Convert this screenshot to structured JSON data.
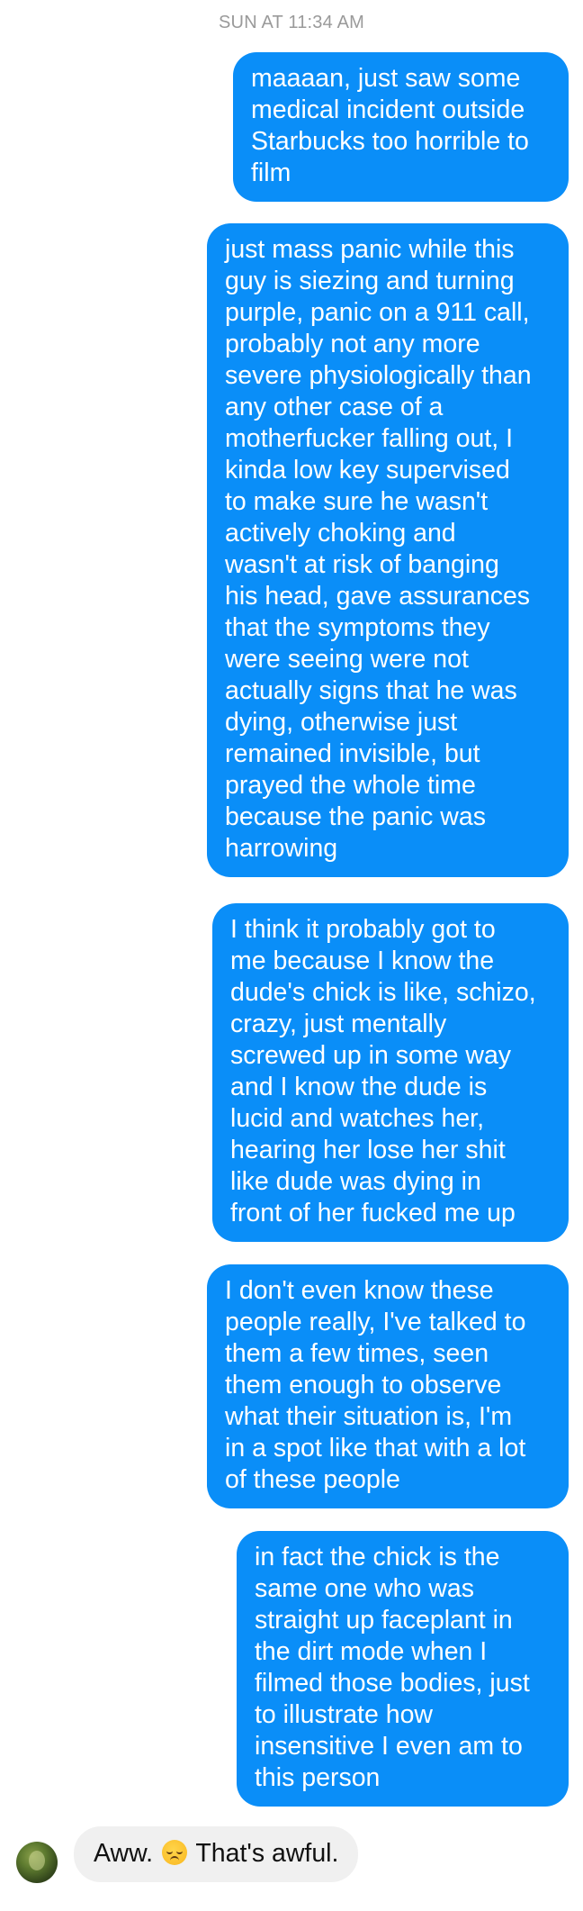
{
  "conversation": {
    "timestamp": "SUN AT 11:34 AM",
    "outgoing_messages": [
      {
        "text": "maaaan, just saw some\nmedical incident outside\nStarbucks too horrible to\nfilm"
      },
      {
        "text": "just mass panic while this\nguy is siezing and turning\npurple, panic on a 911 call,\nprobably not any more\nsevere physiologically than\nany other case of a\nmotherfucker falling out, I\nkinda low key supervised\nto make sure he wasn't\nactively choking and\nwasn't at risk of banging\nhis head, gave assurances\nthat the symptoms they\nwere seeing were not\nactually signs that he was\ndying, otherwise just\nremained invisible, but\nprayed the whole time\nbecause the panic was\nharrowing"
      },
      {
        "text": "I think it probably got to\nme because I know the\ndude's chick is like, schizo,\ncrazy, just mentally\nscrewed up in some way\nand I know the dude is\nlucid and watches her,\nhearing her lose her shit\nlike dude was dying in\nfront of her fucked me up"
      },
      {
        "text": "I don't even know these\npeople really, I've talked to\nthem a few times, seen\nthem enough to observe\nwhat their situation is, I'm\nin a spot like that with a lot\nof these people"
      },
      {
        "text": "in fact the chick is the\nsame one who was\nstraight up faceplant in\nthe dirt mode when I\nfilmed those bodies, just\nto illustrate how\ninsensitive I even am to\nthis person"
      }
    ],
    "incoming_message": {
      "text_before_emoji": "Aww.",
      "emoji_icon": "disappointed-face-icon",
      "text_after_emoji": "That's awful."
    }
  },
  "colors": {
    "outgoing_bubble": "#0a8ef8",
    "incoming_bubble": "#f0f0f0",
    "timestamp_text": "#9a9a9a"
  }
}
